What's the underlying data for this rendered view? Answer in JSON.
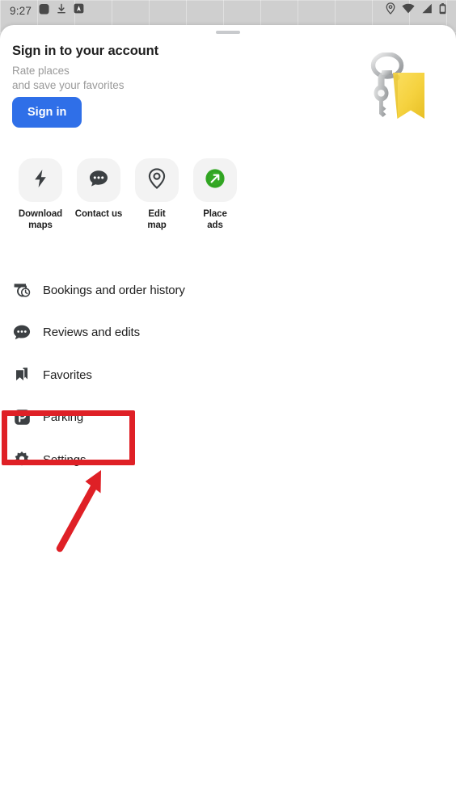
{
  "status_bar": {
    "time": "9:27",
    "left_icons": [
      "app-square-icon",
      "download-icon",
      "android-badge-icon"
    ],
    "right_icons": [
      "location-icon",
      "wifi-icon",
      "signal-icon",
      "battery-icon"
    ]
  },
  "sheet": {
    "drag_handle": "drag-handle"
  },
  "header": {
    "title": "Sign in to your account",
    "subtitle": "Rate places\nand save your favorites",
    "subtitle_line1": "Rate places",
    "subtitle_line2": "and save your favorites",
    "sign_in_label": "Sign in",
    "illustration": "key-with-yellow-tag"
  },
  "quick_actions": [
    {
      "label": "Download\nmaps",
      "line1": "Download",
      "line2": "maps",
      "icon": "lightning-bolt-icon"
    },
    {
      "label": "Contact us",
      "line1": "Contact us",
      "line2": "",
      "icon": "chat-bubble-icon"
    },
    {
      "label": "Edit\nmap",
      "line1": "Edit",
      "line2": "map",
      "icon": "map-pin-icon"
    },
    {
      "label": "Place\nads",
      "line1": "Place",
      "line2": "ads",
      "icon": "green-arrow-pin-icon"
    }
  ],
  "menu": [
    {
      "label": "Bookings and order history",
      "icon": "calendar-clock-icon"
    },
    {
      "label": "Reviews and edits",
      "icon": "chat-bubble-icon"
    },
    {
      "label": "Favorites",
      "icon": "bookmarks-icon"
    },
    {
      "label": "Parking",
      "icon": "parking-p-icon"
    },
    {
      "label": "Settings",
      "icon": "gear-icon"
    }
  ],
  "annotation": {
    "highlight_target": "Settings",
    "highlight_color": "#df2026",
    "arrow_color": "#df2026"
  },
  "colors": {
    "accent_blue": "#2f6fe8",
    "annotation_red": "#df2026",
    "place_ads_green": "#34a924",
    "tile_gray": "#f3f3f3",
    "text_primary": "#1f1f1f",
    "text_secondary": "#9a9a9a"
  }
}
